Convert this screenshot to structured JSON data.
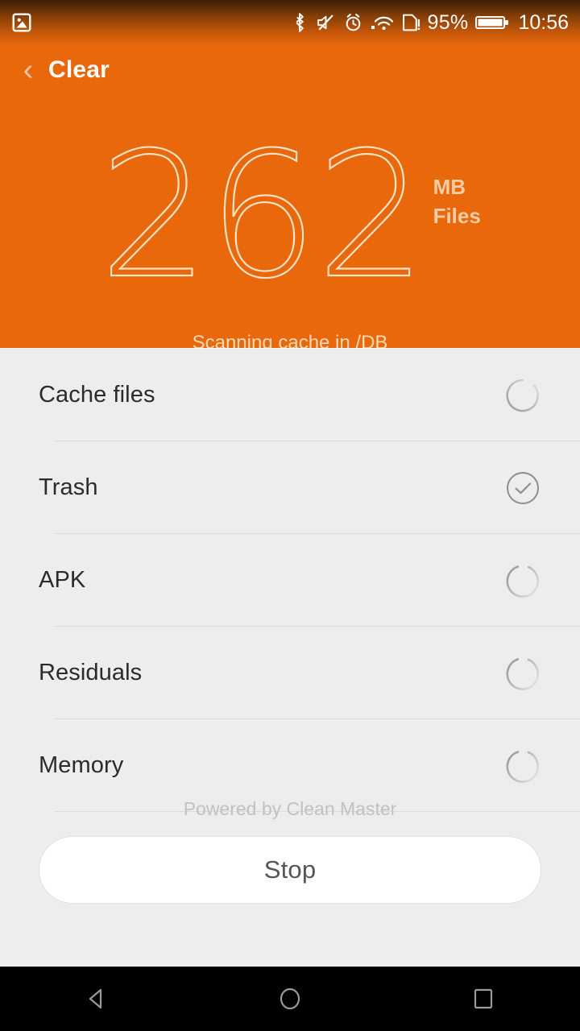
{
  "status_bar": {
    "notification_icon": "image-icon",
    "icons": [
      "bluetooth-icon",
      "mute-icon",
      "alarm-icon",
      "wifi-icon",
      "sim-card-icon"
    ],
    "battery_percent": "95%",
    "battery_icon": "battery-icon",
    "time": "10:56"
  },
  "action_bar": {
    "back_icon": "back-chevron-icon",
    "title": "Clear"
  },
  "hero": {
    "amount": "262",
    "unit": "MB",
    "unit_sub": "Files",
    "scan_path": "Scanning cache in /DB",
    "bg_color": "#E8680B",
    "number_stroke_color": "#FAE3C8",
    "unit_color": "#F6CDA4"
  },
  "list": {
    "rows": [
      {
        "label": "Cache files",
        "status": "scanning",
        "icon": "spinner-icon"
      },
      {
        "label": "Trash",
        "status": "done",
        "icon": "check-circle-icon"
      },
      {
        "label": "APK",
        "status": "scanning",
        "icon": "spinner-icon"
      },
      {
        "label": "Residuals",
        "status": "scanning",
        "icon": "spinner-icon"
      },
      {
        "label": "Memory",
        "status": "scanning",
        "icon": "spinner-icon"
      }
    ]
  },
  "footer": {
    "powered_by": "Powered by Clean Master",
    "stop_label": "Stop"
  },
  "nav_bar": {
    "back": "back-triangle-icon",
    "home": "home-circle-icon",
    "recents": "recents-square-icon"
  },
  "colors": {
    "accent": "#E8680B",
    "panel_bg": "#ECEEED",
    "divider": "#D9DBDA",
    "text_primary": "#2b2b2b",
    "text_muted": "#BFC2C1",
    "nav_bg": "#000000"
  }
}
